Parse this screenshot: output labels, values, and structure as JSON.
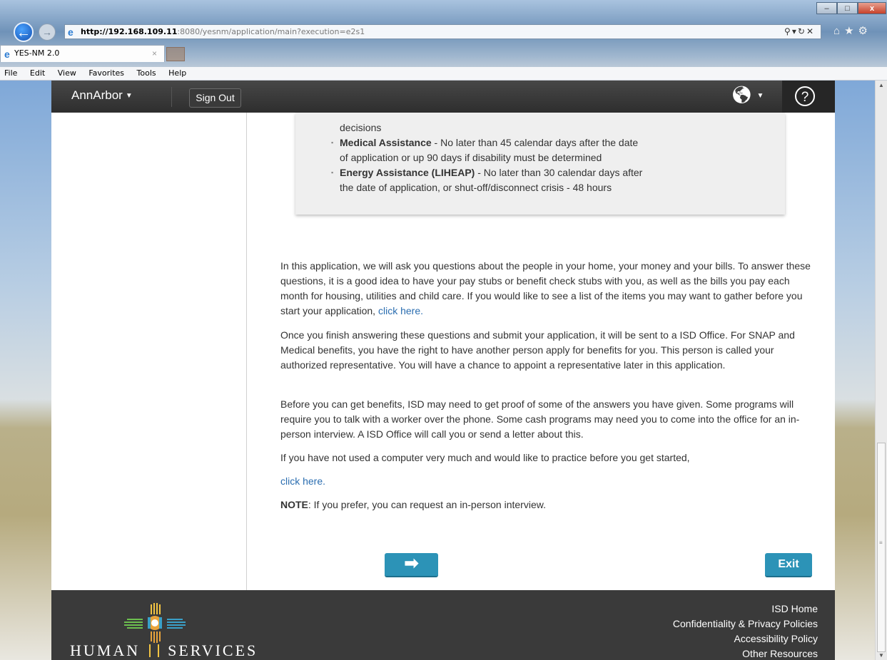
{
  "browser": {
    "address_host": "http://192.168.109.11",
    "address_rest": ":8080/yesnm/application/main?execution=e2s1",
    "tab_title": "YES-NM 2.0",
    "menu": [
      "File",
      "Edit",
      "View",
      "Favorites",
      "Tools",
      "Help"
    ]
  },
  "header": {
    "user_name": "AnnArbor",
    "sign_out": "Sign Out",
    "help_glyph": "?"
  },
  "timeframes": [
    {
      "program": "",
      "text": "decisions"
    },
    {
      "program": "Medical Assistance",
      "text": " - No later than 45 calendar days after the date"
    },
    {
      "program": "",
      "text": "of application or up 90 days if disability must be determined"
    },
    {
      "program": "Energy Assistance (LIHEAP)",
      "text": " - No later than 30 calendar days after"
    },
    {
      "program": "",
      "text": "the date of application, or shut-off/disconnect crisis - 48 hours"
    }
  ],
  "content": {
    "p1": "In this application, we will ask you questions about the people in your home, your money and your bills. To answer these questions, it is a good idea to have your pay stubs or benefit check stubs with you, as well as the bills you pay each month for housing, utilities and child care. If you would like to see a list of the items you may want to gather before you start your application,",
    "p1_link": "click here.",
    "p2": "Once you finish answering these questions and submit your application, it will be sent to a ISD Office. For SNAP and Medical benefits, you have the right to have another person apply for benefits for you. This person is called your authorized representative. You will have a chance to appoint a representative later in this application.",
    "p3": "Before you can get benefits, ISD may need to get proof of some of the answers you have given. Some programs will require you to talk with a worker over the phone. Some cash programs may need you to come into the office for an in-person interview. A ISD Office will call you or send a letter about this.",
    "p4": "If you have not used a computer very much and would like to practice before you get started,",
    "p4_link": "click here.",
    "note_label": "NOTE",
    "note_text": ": If you prefer, you can request an in-person interview."
  },
  "buttons": {
    "next_glyph": "➡",
    "exit": "Exit"
  },
  "footer": {
    "logo_left": "HUMAN",
    "logo_right": "SERVICES",
    "links": [
      "ISD Home",
      "Confidentiality & Privacy Policies",
      "Accessibility Policy",
      "Other Resources"
    ]
  },
  "colors": {
    "accent": "#2c93b7",
    "header": "#333333",
    "footer": "#3a3a3a",
    "link": "#2a6db0"
  }
}
